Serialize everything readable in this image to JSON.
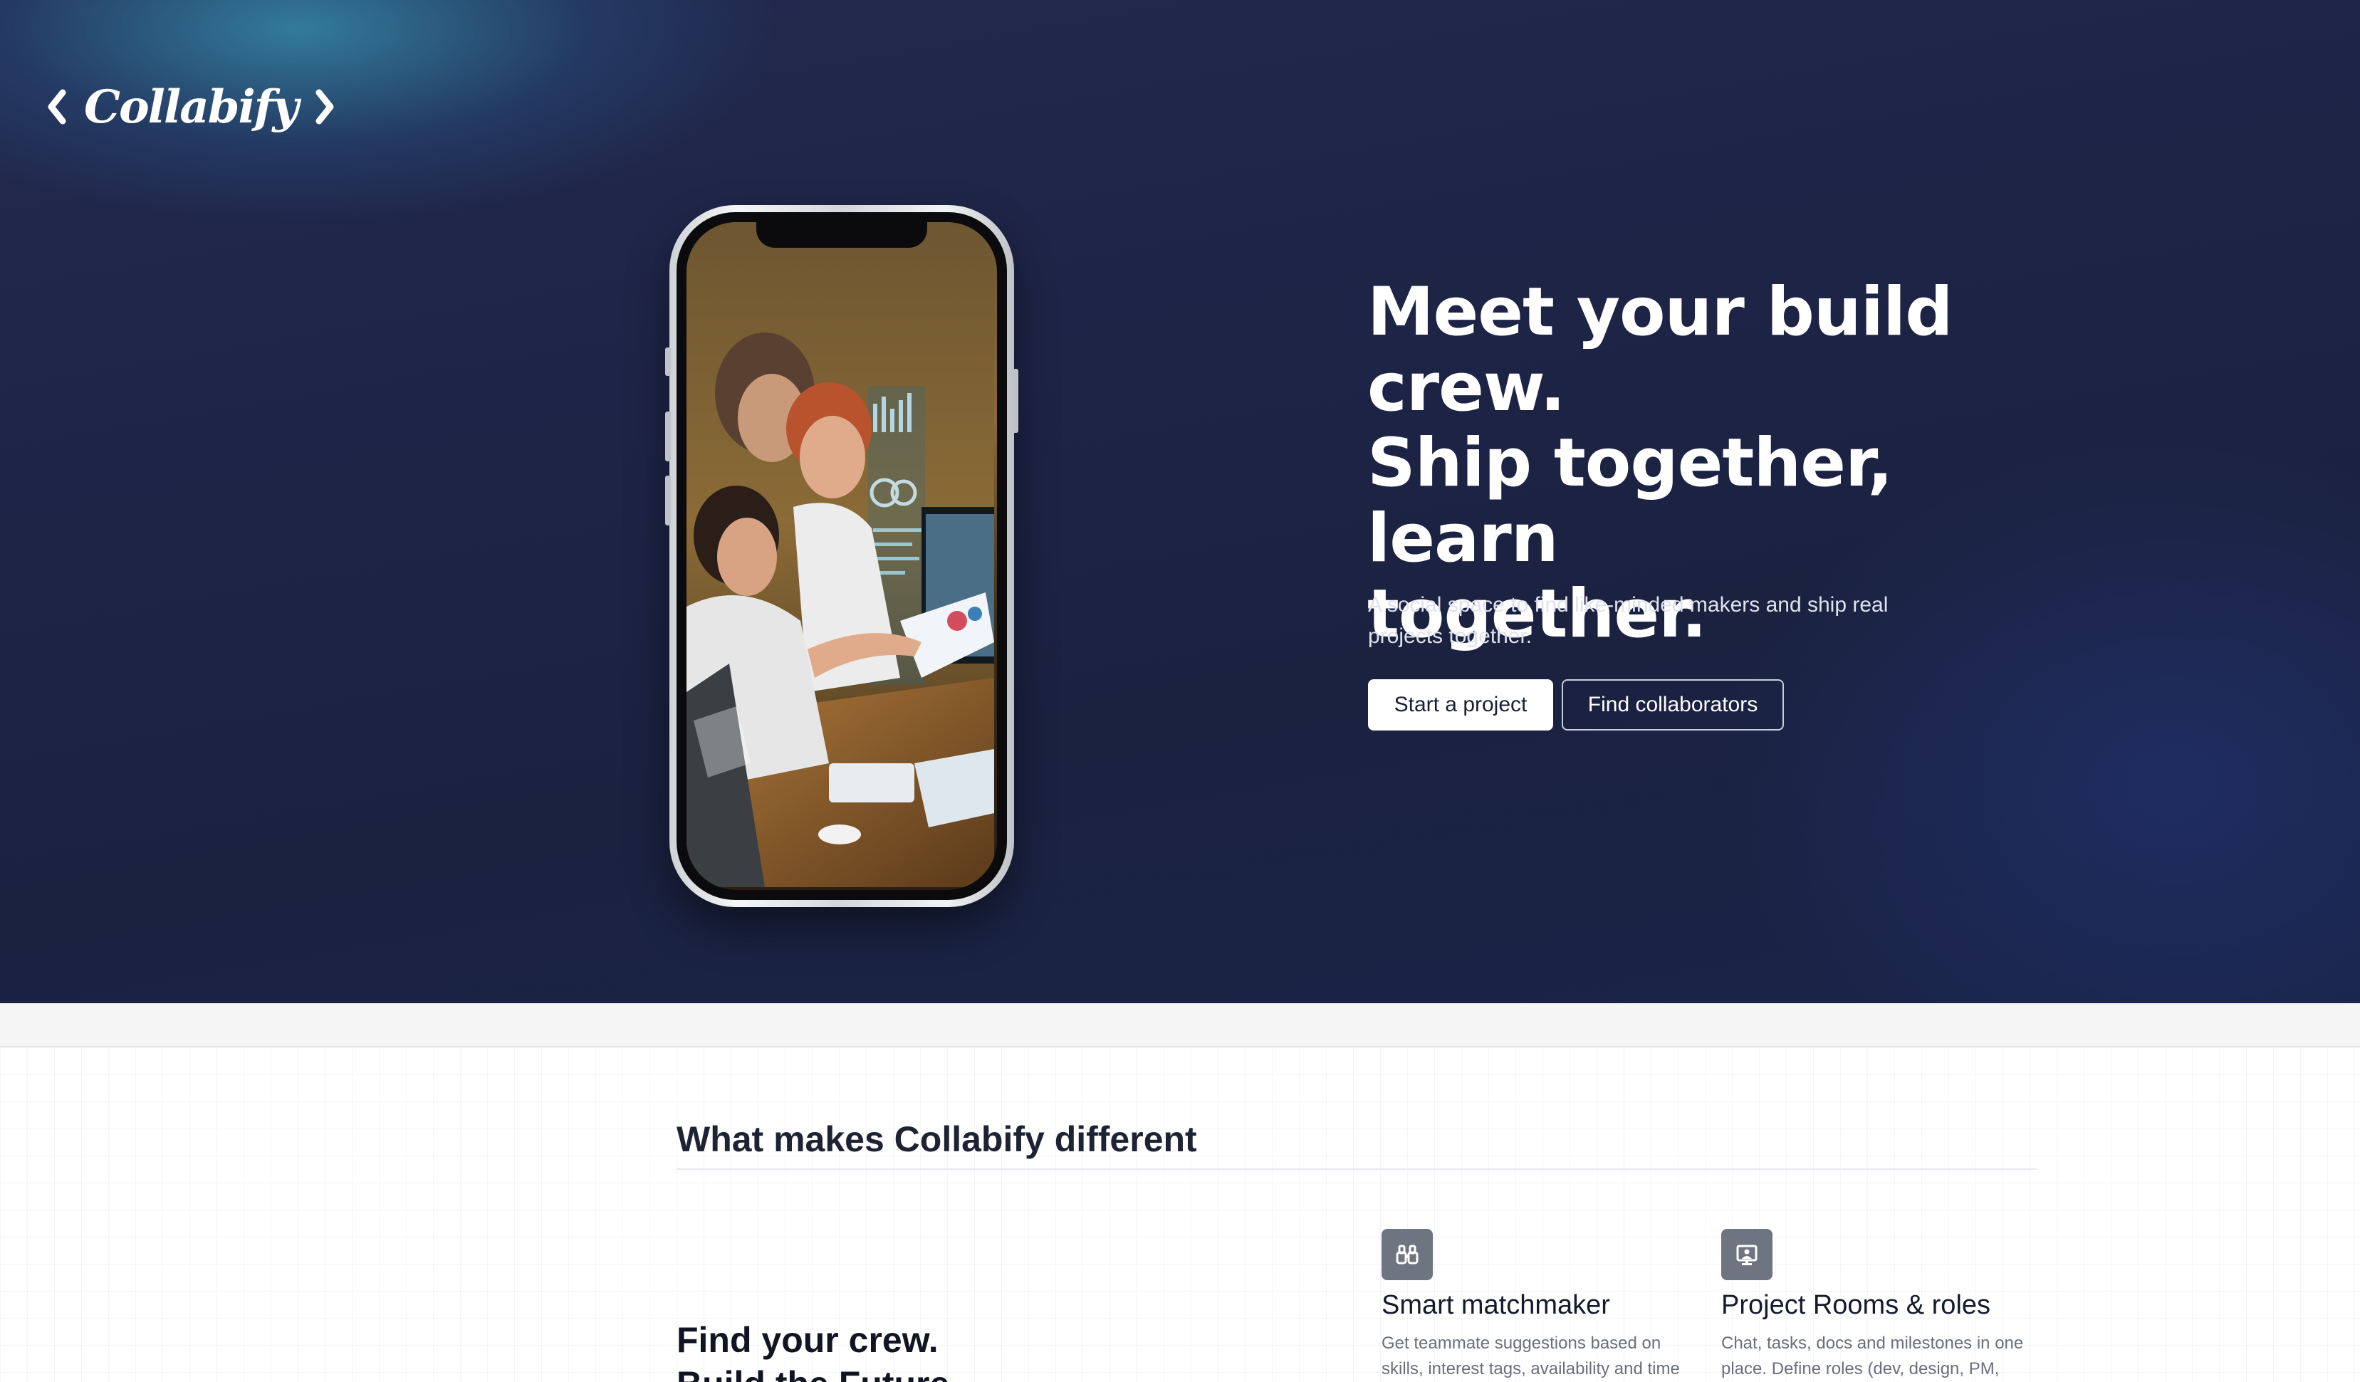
{
  "brand": {
    "name": "Collabify"
  },
  "hero": {
    "headline_lines": [
      "Meet your build",
      "crew.",
      "Ship together, learn",
      "together."
    ],
    "subtext": "A social space to find like-minded makers and ship real projects together.",
    "primary_cta": "Start a project",
    "secondary_cta": "Find collaborators",
    "phone_image": "people-collaborating-at-desk-photo"
  },
  "features": {
    "section_title": "What makes Collabify different",
    "crew_title_lines": [
      "Find your crew.",
      "Build the Future"
    ],
    "items": [
      {
        "icon": "binoculars-icon",
        "title": "Smart matchmaker",
        "desc": "Get teammate suggestions based on skills, interest tags, availability and time"
      },
      {
        "icon": "presentation-icon",
        "title": "Project Rooms & roles",
        "desc": "Chat, tasks, docs and milestones in one place. Define roles (dev, design, PM,"
      }
    ]
  },
  "colors": {
    "hero_bg": "#1e2447",
    "accent_glow": "#3896b4",
    "primary_button_bg": "#ffffff",
    "icon_tile": "#6e7480"
  }
}
